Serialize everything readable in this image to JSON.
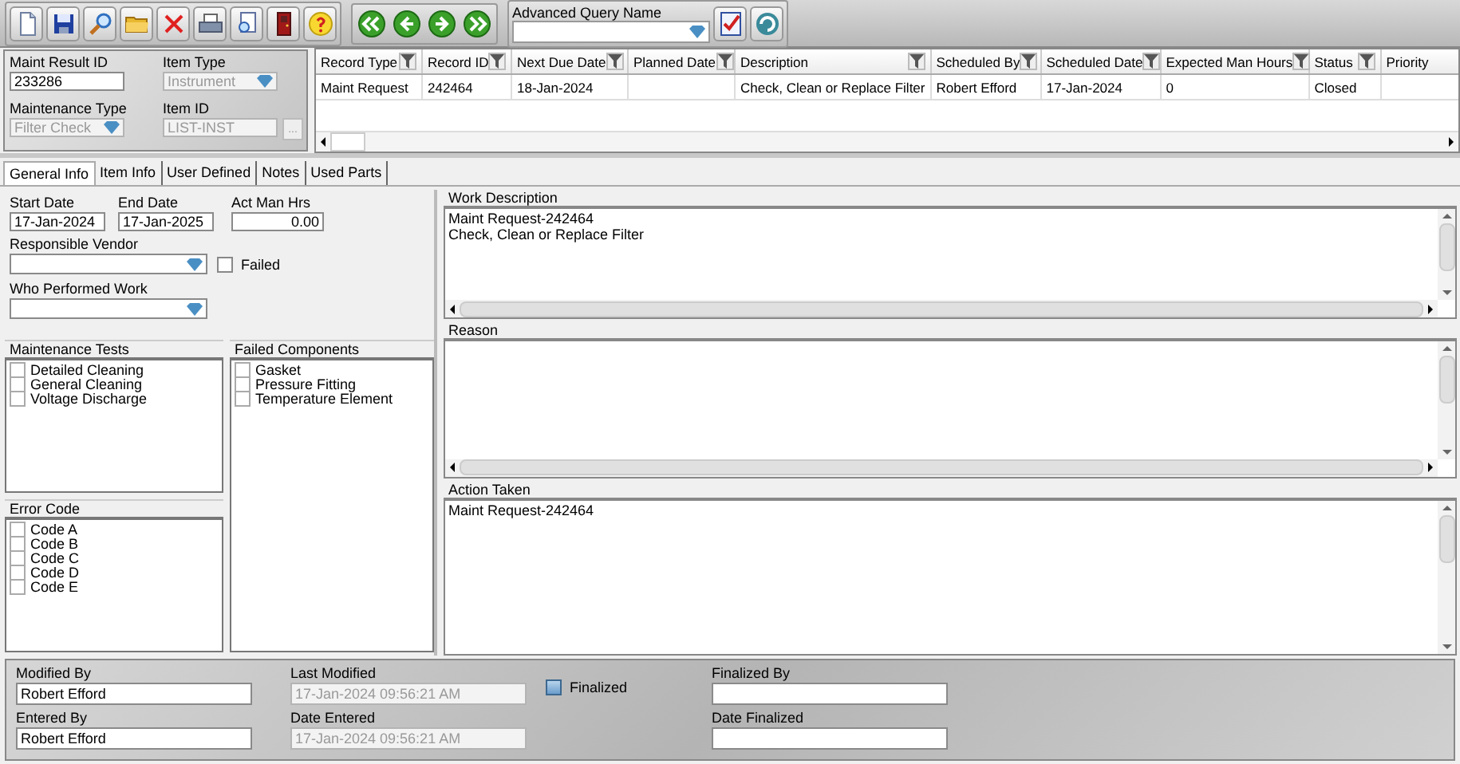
{
  "toolbar": {
    "query_label": "Advanced Query Name"
  },
  "header": {
    "fields": [
      {
        "kind": "text",
        "label": "Maint Result ID",
        "value": "233286",
        "disabled": false
      },
      {
        "kind": "combo",
        "label": "Item Type",
        "value": "Instrument",
        "disabled": true
      },
      {
        "kind": "combo",
        "label": "Maintenance Type",
        "value": "Filter Check",
        "disabled": true
      },
      {
        "kind": "lookup",
        "label": "Item ID",
        "value": "LIST-INST",
        "disabled": true,
        "button": "..."
      }
    ]
  },
  "grid": {
    "columns": [
      "Record Type",
      "Record ID",
      "Next Due Date",
      "Planned Date",
      "Description",
      "Scheduled By",
      "Scheduled Date",
      "Expected Man Hours",
      "Status",
      "Priority"
    ],
    "rows": [
      {
        "selected": false,
        "cells": [
          "Maint Request",
          "242464",
          "18-Jan-2024",
          "",
          "Check, Clean or Replace Filter",
          "Robert Efford",
          "17-Jan-2024",
          "0",
          "Closed",
          ""
        ]
      }
    ]
  },
  "tabs": [
    {
      "label": "General Info",
      "selected": true
    },
    {
      "label": "Item Info",
      "selected": false
    },
    {
      "label": "User Defined",
      "selected": false
    },
    {
      "label": "Notes",
      "selected": false
    },
    {
      "label": "Used Parts",
      "selected": false
    }
  ],
  "general": {
    "dates": [
      {
        "label": "Start Date",
        "value": "17-Jan-2024"
      },
      {
        "label": "End Date",
        "value": "17-Jan-2025"
      },
      {
        "label": "Act Man Hrs",
        "value": "0.00"
      }
    ],
    "vendor": {
      "label": "Responsible Vendor"
    },
    "failed": {
      "label": "Failed",
      "checked": false
    },
    "performer": {
      "label": "Who Performed Work"
    },
    "lists": [
      {
        "title": "Maintenance Tests",
        "items": [
          {
            "label": "Detailed Cleaning",
            "checked": false
          },
          {
            "label": "General Cleaning",
            "checked": false
          },
          {
            "label": "Voltage Discharge",
            "checked": false
          }
        ]
      },
      {
        "title": "Error Code",
        "items": [
          {
            "label": "Code A",
            "checked": false
          },
          {
            "label": "Code B",
            "checked": false
          },
          {
            "label": "Code C",
            "checked": false
          },
          {
            "label": "Code D",
            "checked": false
          },
          {
            "label": "Code E",
            "checked": false
          }
        ]
      },
      {
        "title": "Failed Components",
        "items": [
          {
            "label": "Gasket",
            "checked": false
          },
          {
            "label": "Pressure Fitting",
            "checked": false
          },
          {
            "label": "Temperature Element",
            "checked": false
          }
        ]
      }
    ]
  },
  "notes": [
    {
      "title": "Work Description",
      "lines": [
        "Maint Request-242464",
        "Check, Clean or Replace Filter"
      ]
    },
    {
      "title": "Reason"
    },
    {
      "title": "Action Taken",
      "lines": [
        "Maint Request-242464"
      ]
    }
  ],
  "footer": {
    "fields": [
      {
        "label": "Modified By",
        "value": "Robert Efford",
        "disabled": false
      },
      {
        "label": "Last Modified",
        "value": "17-Jan-2024 09:56:21 AM",
        "disabled": true
      },
      {
        "label": "Finalized By",
        "disabled": false
      },
      {
        "label": "Entered By",
        "value": "Robert Efford",
        "disabled": false
      },
      {
        "label": "Date Entered",
        "value": "17-Jan-2024 09:56:21 AM",
        "disabled": true
      },
      {
        "label": "Date Finalized",
        "disabled": false
      }
    ],
    "finalized": {
      "label": "Finalized",
      "checked": false
    }
  }
}
